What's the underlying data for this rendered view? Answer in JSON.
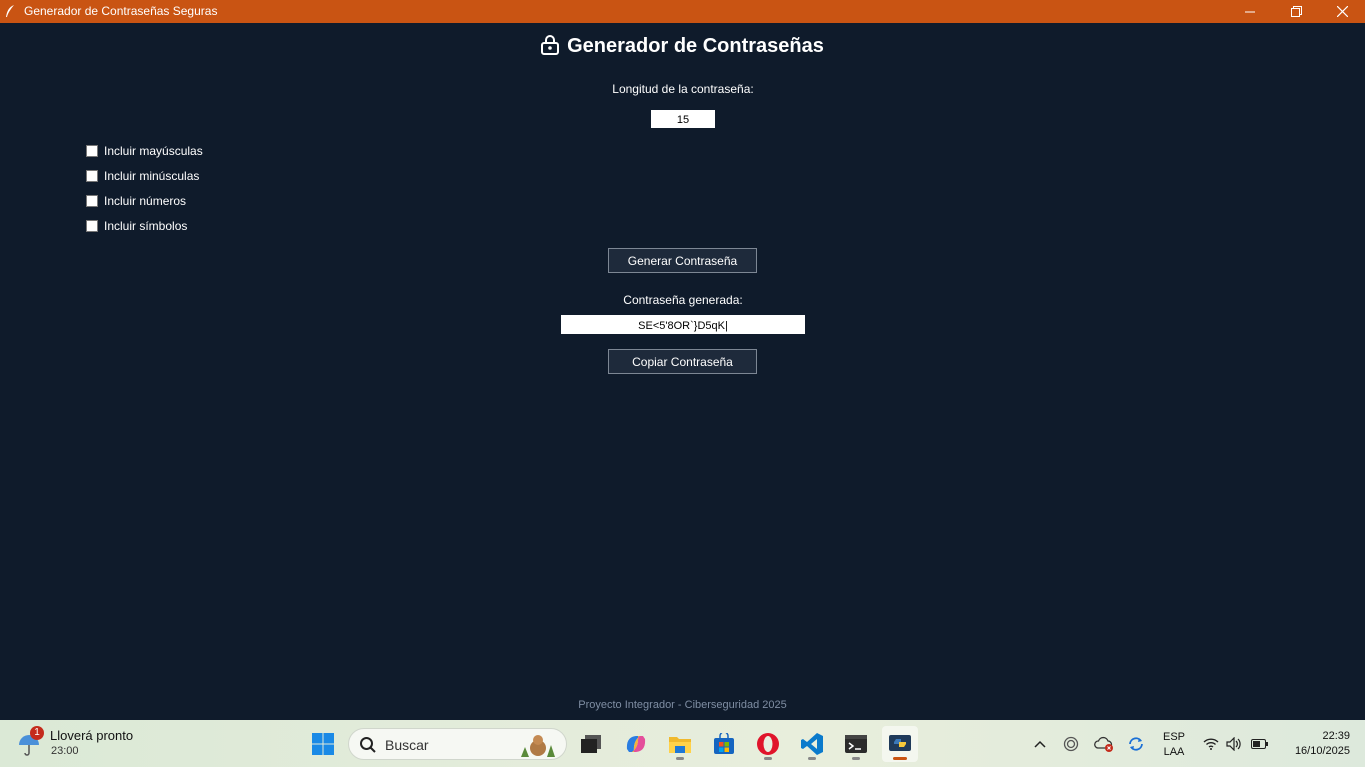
{
  "window": {
    "title": "Generador de Contraseñas Seguras",
    "accent_color": "#c95413",
    "background_color": "#0f1b2b"
  },
  "app": {
    "title": "Generador de Contraseñas",
    "title_icon": "lock-icon",
    "length_label": "Longitud de la contraseña:",
    "length_value": "15",
    "checkboxes": [
      {
        "label": "Incluir mayúsculas",
        "checked": false
      },
      {
        "label": "Incluir minúsculas",
        "checked": false
      },
      {
        "label": "Incluir números",
        "checked": false
      },
      {
        "label": "Incluir símbolos",
        "checked": false
      }
    ],
    "generate_button": "Generar Contraseña",
    "generated_label": "Contraseña generada:",
    "generated_value": "SE<5'8OR`}D5qK|",
    "copy_button": "Copiar Contraseña",
    "footer": "Proyecto Integrador - Ciberseguridad 2025"
  },
  "taskbar": {
    "weather": {
      "badge": "1",
      "text": "Lloverá pronto",
      "time": "23:00"
    },
    "search_placeholder": "Buscar",
    "pinned_apps": [
      "windows-start-icon",
      "task-view-icon",
      "copilot-icon",
      "file-explorer-icon",
      "microsoft-store-icon",
      "opera-icon",
      "vscode-icon",
      "terminal-icon",
      "python-icon"
    ],
    "language": {
      "line1": "ESP",
      "line2": "LAA"
    },
    "clock": {
      "time": "22:39",
      "date": "16/10/2025"
    }
  }
}
